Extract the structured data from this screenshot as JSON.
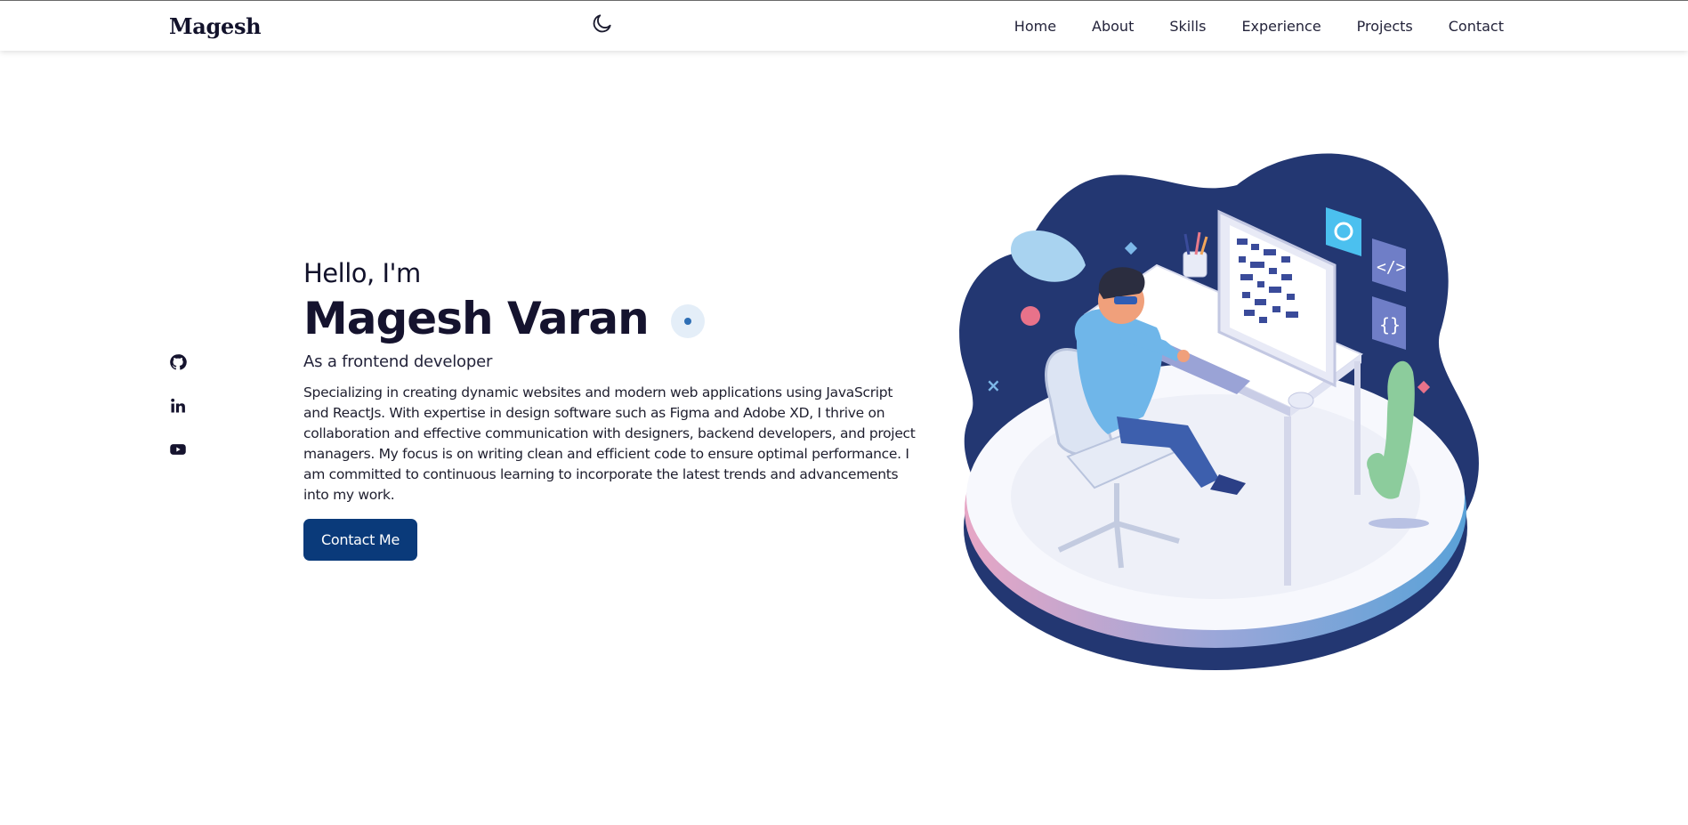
{
  "nav": {
    "logo": "Magesh",
    "theme_icon": "moon-icon",
    "links": [
      "Home",
      "About",
      "Skills",
      "Experience",
      "Projects",
      "Contact"
    ]
  },
  "socials": [
    {
      "icon": "github-icon"
    },
    {
      "icon": "linkedin-icon"
    },
    {
      "icon": "youtube-icon"
    }
  ],
  "hero": {
    "greeting": "Hello, I'm",
    "name": "Magesh Varan",
    "role": "As a frontend developer",
    "description": "Specializing in creating dynamic websites and modern web applications using JavaScript and ReactJs. With expertise in design software such as Figma and Adobe XD, I thrive on collaboration and effective communication with designers, backend developers, and project managers. My focus is on writing clean and efficient code to ensure optimal performance. I am committed to continuous learning to incorporate the latest trends and advancements into my work.",
    "cta_label": "Contact Me"
  },
  "colors": {
    "primary_dark": "#12122b",
    "button": "#0a3a7a",
    "blob": "#233772",
    "accent_blue": "#2f6fb5"
  }
}
